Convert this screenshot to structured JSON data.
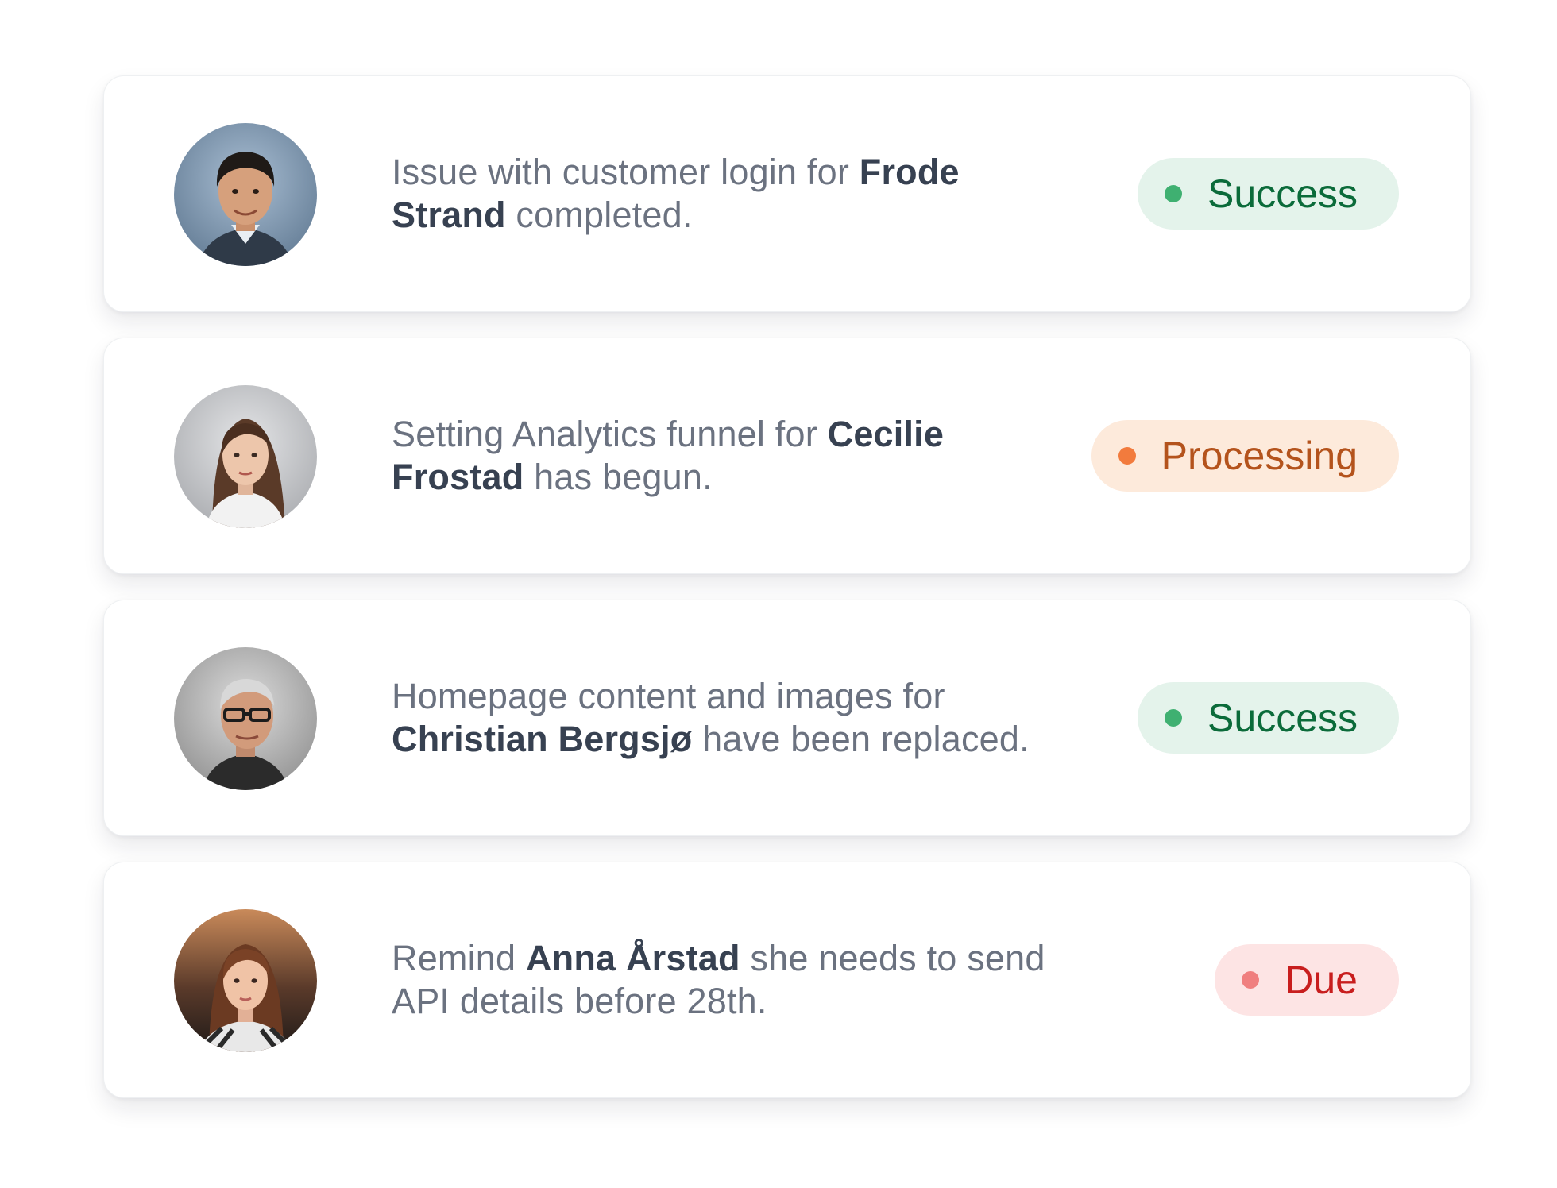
{
  "activity_items": [
    {
      "avatar": "man-portrait-avatar",
      "message": [
        {
          "text": "Issue with customer login for ",
          "bold": false
        },
        {
          "text": "Frode Strand",
          "bold": true
        },
        {
          "text": " completed.",
          "bold": false
        }
      ],
      "status": {
        "label": "Success",
        "type": "success"
      }
    },
    {
      "avatar": "woman-portrait-avatar",
      "message": [
        {
          "text": "Setting Analytics funnel for ",
          "bold": false
        },
        {
          "text": "Cecilie Frostad",
          "bold": true
        },
        {
          "text": " has begun.",
          "bold": false
        }
      ],
      "status": {
        "label": "Processing",
        "type": "processing"
      }
    },
    {
      "avatar": "older-man-portrait-avatar",
      "message": [
        {
          "text": "Homepage content and images for ",
          "bold": false
        },
        {
          "text": "Christian Bergsjø",
          "bold": true
        },
        {
          "text": " have been replaced.",
          "bold": false
        }
      ],
      "status": {
        "label": "Success",
        "type": "success"
      }
    },
    {
      "avatar": "young-woman-portrait-avatar",
      "message": [
        {
          "text": "Remind ",
          "bold": false
        },
        {
          "text": "Anna Årstad",
          "bold": true
        },
        {
          "text": " she needs to send API details before 28th.",
          "bold": false
        }
      ],
      "status": {
        "label": "Due",
        "type": "due"
      }
    }
  ],
  "colors": {
    "success_bg": "#e4f3eb",
    "success_text": "#0b6b3a",
    "success_dot": "#3fb071",
    "processing_bg": "#fdeadb",
    "processing_text": "#b4531c",
    "processing_dot": "#f27b3d",
    "due_bg": "#fde4e4",
    "due_text": "#c81e1e",
    "due_dot": "#f07f7f",
    "body_text": "#6b7280",
    "name_text": "#374151"
  }
}
